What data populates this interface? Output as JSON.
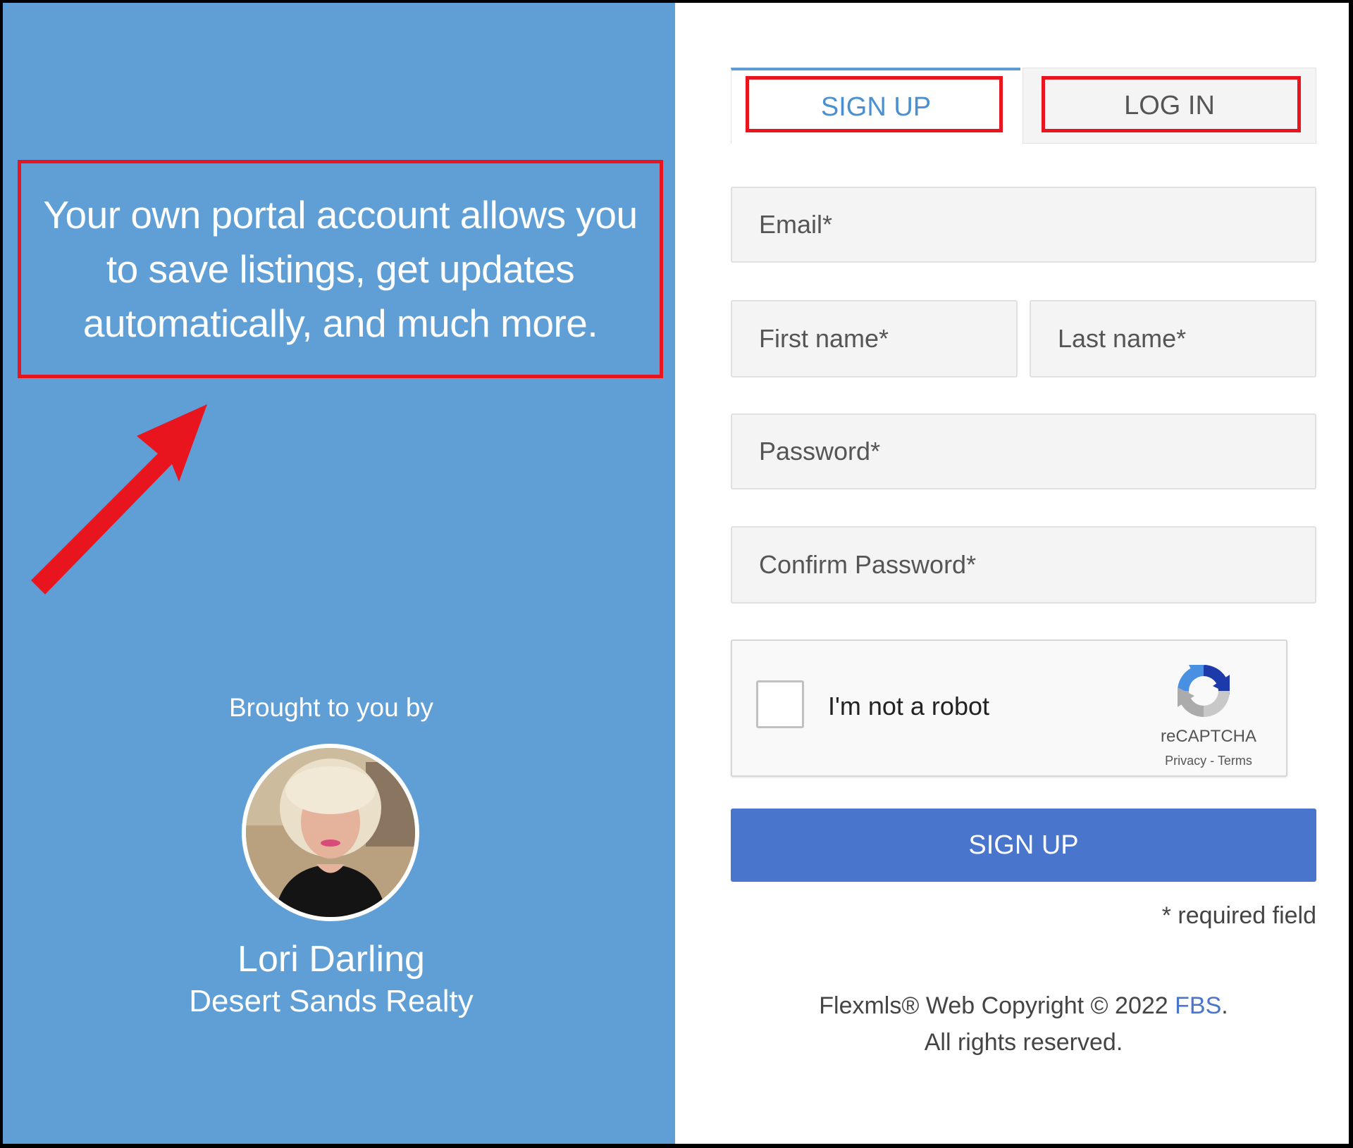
{
  "left_panel": {
    "tagline": "Your own portal account allows you to save listings, get updates automatically, and much more.",
    "brought_by": "Brought to you by",
    "agent_name": "Lori Darling",
    "agent_company": "Desert Sands Realty"
  },
  "tabs": {
    "signup": "SIGN UP",
    "login": "LOG IN",
    "active": "signup"
  },
  "form": {
    "email_placeholder": "Email*",
    "first_name_placeholder": "First name*",
    "last_name_placeholder": "Last name*",
    "password_placeholder": "Password*",
    "confirm_password_placeholder": "Confirm Password*",
    "submit_label": "SIGN UP",
    "required_note": "* required field"
  },
  "recaptcha": {
    "label": "I'm not a robot",
    "brand": "reCAPTCHA",
    "privacy": "Privacy",
    "separator": "-",
    "terms": "Terms"
  },
  "footer": {
    "copyright_prefix": "Flexmls® Web Copyright © 2022",
    "company_link": "FBS",
    "copyright_suffix": ".",
    "rights": "All rights reserved."
  },
  "colors": {
    "left_panel_bg": "#5f9fd6",
    "accent_blue": "#4a75cc",
    "highlight_red": "#e8141e"
  }
}
